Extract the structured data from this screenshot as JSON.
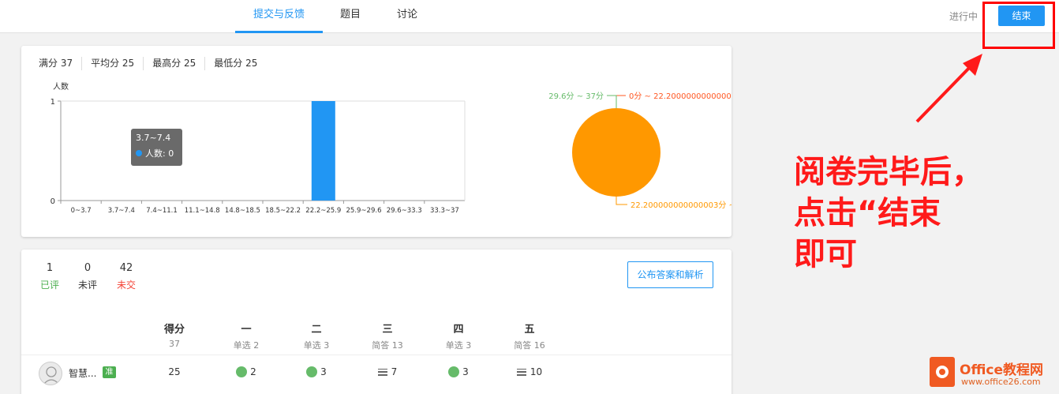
{
  "header": {
    "tabs": [
      {
        "label": "提交与反馈",
        "active": true
      },
      {
        "label": "题目",
        "active": false
      },
      {
        "label": "讨论",
        "active": false
      }
    ],
    "status": "进行中",
    "end_button": "结束"
  },
  "summary": {
    "full_score": "满分 37",
    "average": "平均分 25",
    "highest": "最高分 25",
    "lowest": "最低分 25"
  },
  "chart_data": [
    {
      "type": "bar",
      "ylabel": "人数",
      "ylim": [
        0,
        1
      ],
      "yticks": [
        "0",
        "1"
      ],
      "categories": [
        "0~3.7",
        "3.7~7.4",
        "7.4~11.1",
        "11.1~14.8",
        "14.8~18.5",
        "18.5~22.2",
        "22.2~25.9",
        "25.9~29.6",
        "29.6~33.3",
        "33.3~37"
      ],
      "series": [
        {
          "name": "人数",
          "values": [
            0,
            0,
            0,
            0,
            0,
            0,
            1,
            0,
            0,
            0
          ],
          "color": "#2196f3"
        }
      ],
      "tooltip": {
        "title": "3.7~7.4",
        "label": "人数: 0"
      }
    },
    {
      "type": "pie",
      "slices": [
        {
          "label": "0分 ~ 22.2000000000000",
          "value": 0,
          "color": "#ff5722"
        },
        {
          "label": "22.200000000000003分 ~",
          "value": 1,
          "color": "#ff9800"
        },
        {
          "label": "29.6分 ~ 37分",
          "value": 0,
          "color": "#66bb6a"
        }
      ]
    }
  ],
  "counts": [
    {
      "num": "1",
      "label": "已评",
      "color": "#4caf50"
    },
    {
      "num": "0",
      "label": "未评",
      "color": "#333333"
    },
    {
      "num": "42",
      "label": "未交",
      "color": "#f44336"
    }
  ],
  "publish_button": "公布答案和解析",
  "columns": [
    {
      "title": "得分",
      "sub": "37"
    },
    {
      "title": "一",
      "sub": "单选 2"
    },
    {
      "title": "二",
      "sub": "单选 3"
    },
    {
      "title": "三",
      "sub": "简答 13"
    },
    {
      "title": "四",
      "sub": "单选 3"
    },
    {
      "title": "五",
      "sub": "简答 16"
    }
  ],
  "student": {
    "name": "智慧...",
    "badge": "准",
    "score": "25",
    "answers": [
      {
        "icon": "green-dot-icon",
        "value": "2"
      },
      {
        "icon": "green-dot-icon",
        "value": "3"
      },
      {
        "icon": "lines-icon",
        "value": "7"
      },
      {
        "icon": "green-dot-icon",
        "value": "3"
      },
      {
        "icon": "lines-icon",
        "value": "10"
      }
    ]
  },
  "annotation": {
    "line1": "阅卷完毕后，",
    "line2": "点击“结束",
    "line3": "即可"
  },
  "watermark": {
    "title": "Office教程网",
    "url": "www.office26.com"
  }
}
